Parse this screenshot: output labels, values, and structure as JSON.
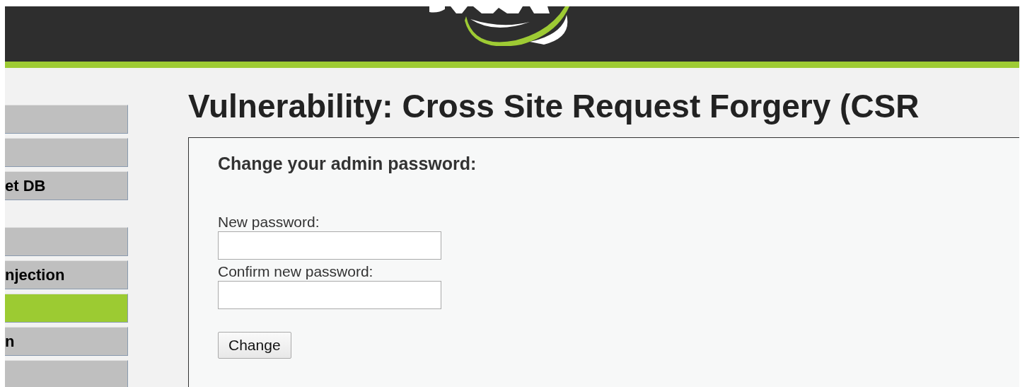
{
  "menu": {
    "groups": [
      {
        "items": [
          {
            "selected": false
          },
          {
            "selected": false
          },
          {
            "label": "et DB",
            "selected": false
          }
        ]
      },
      {
        "items": [
          {
            "selected": false
          },
          {
            "label": "njection",
            "selected": false
          },
          {
            "selected": true
          },
          {
            "label": "n",
            "selected": false
          },
          {
            "selected": false
          }
        ]
      }
    ]
  },
  "page_title": "Vulnerability: Cross Site Request Forgery (CSR",
  "form": {
    "heading": "Change your admin password:",
    "fields": [
      {
        "label": "New password:"
      },
      {
        "label": "Confirm new password:"
      }
    ],
    "submit": "Change"
  }
}
